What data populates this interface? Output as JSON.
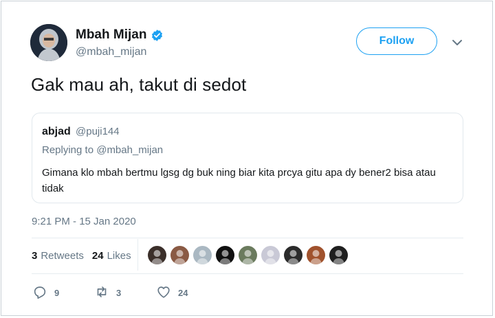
{
  "author": {
    "name": "Mbah Mijan",
    "handle": "@mbah_mijan",
    "verified": true,
    "follow_label": "Follow"
  },
  "tweet": {
    "text": "Gak mau ah, takut di sedot",
    "timestamp": "9:21 PM - 15 Jan 2020"
  },
  "quoted": {
    "name": "abjad",
    "handle": "@puji144",
    "replying_to": "Replying to @mbah_mijan",
    "text": "Gimana klo mbah bertmu lgsg dg buk ning biar kita prcya gitu apa dy bener2 bisa atau tidak"
  },
  "stats": {
    "retweets_count": "3",
    "retweets_label": "Retweets",
    "likes_count": "24",
    "likes_label": "Likes"
  },
  "likers": [
    {
      "color": "#3b2f2a"
    },
    {
      "color": "#8a5a44"
    },
    {
      "color": "#aab8c2"
    },
    {
      "color": "#111111"
    },
    {
      "color": "#6b7b5e"
    },
    {
      "color": "#c9c9d6"
    },
    {
      "color": "#2b2b2b"
    },
    {
      "color": "#a0522d"
    },
    {
      "color": "#1f1f1f"
    }
  ],
  "actions": {
    "reply_count": "9",
    "retweet_count": "3",
    "like_count": "24"
  },
  "colors": {
    "accent": "#1da1f2",
    "secondary_text": "#657786",
    "border": "#e1e8ed"
  }
}
